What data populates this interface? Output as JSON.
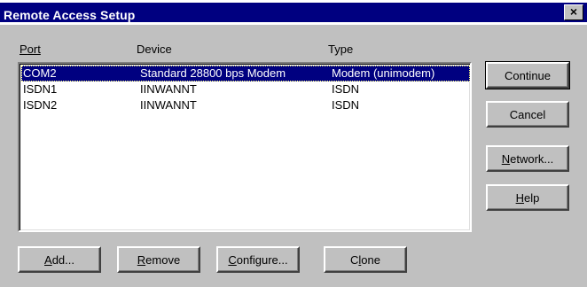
{
  "window": {
    "title": "Remote Access Setup",
    "close_glyph": "×"
  },
  "columns": {
    "port": "Port",
    "device": "Device",
    "type": "Type"
  },
  "rows": [
    {
      "port": "COM2",
      "device": "Standard 28800 bps Modem",
      "type": "Modem (unimodem)",
      "selected": true
    },
    {
      "port": "ISDN1",
      "device": "IINWANNT",
      "type": "ISDN",
      "selected": false
    },
    {
      "port": "ISDN2",
      "device": "IINWANNT",
      "type": "ISDN",
      "selected": false
    }
  ],
  "side_buttons": {
    "continue": "Continue",
    "cancel": "Cancel",
    "network": "Network...",
    "help": "Help"
  },
  "bottom_buttons": {
    "add": "Add...",
    "remove": "Remove",
    "configure": "Configure...",
    "clone": "Clone"
  },
  "colors": {
    "title_bar": "#000080",
    "selection": "#000080",
    "face": "#c0c0c0"
  }
}
